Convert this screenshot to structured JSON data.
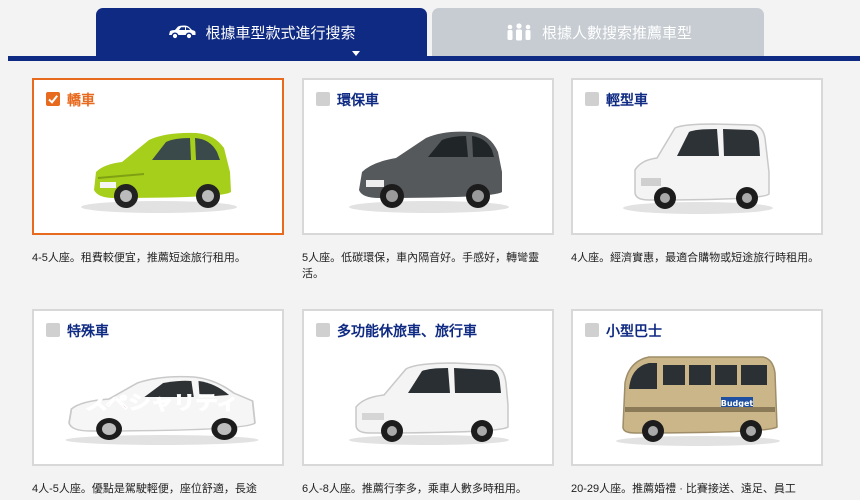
{
  "tabs": [
    {
      "label": "根據車型款式進行搜索",
      "icon": "car-icon",
      "active": true
    },
    {
      "label": "根據人數搜索推薦車型",
      "icon": "people-icon",
      "active": false
    }
  ],
  "colors": {
    "primary": "#0f2a82",
    "selected": "#e86a1f",
    "tab_inactive": "#c6ccd2"
  },
  "cards": [
    {
      "title": "轎車",
      "checked": true,
      "car": "lime-green-hatchback",
      "description": "4-5人座。租費較便宜，推薦短途旅行租用。"
    },
    {
      "title": "環保車",
      "checked": false,
      "car": "dark-gray-hybrid",
      "description": "5人座。低碳環保，車內隔音好。手感好，轉彎靈活。"
    },
    {
      "title": "輕型車",
      "checked": false,
      "car": "white-kei-car",
      "description": "4人座。經濟實惠，最適合購物或短途旅行時租用。"
    },
    {
      "title": "特殊車",
      "checked": false,
      "car": "white-luxury-sedan",
      "overlay_text": "スペシャリティ",
      "description": "4人-5人座。優點是駕駛輕便，座位舒適，長途"
    },
    {
      "title": "多功能休旅車、旅行車",
      "checked": false,
      "car": "white-minivan",
      "description": "6人-8人座。推薦行李多，乘車人數多時租用。"
    },
    {
      "title": "小型巴士",
      "checked": false,
      "car": "beige-minibus",
      "overlay_text": "Budget",
      "description": "20-29人座。推薦婚禮 · 比賽接送、遠足、員工"
    }
  ]
}
